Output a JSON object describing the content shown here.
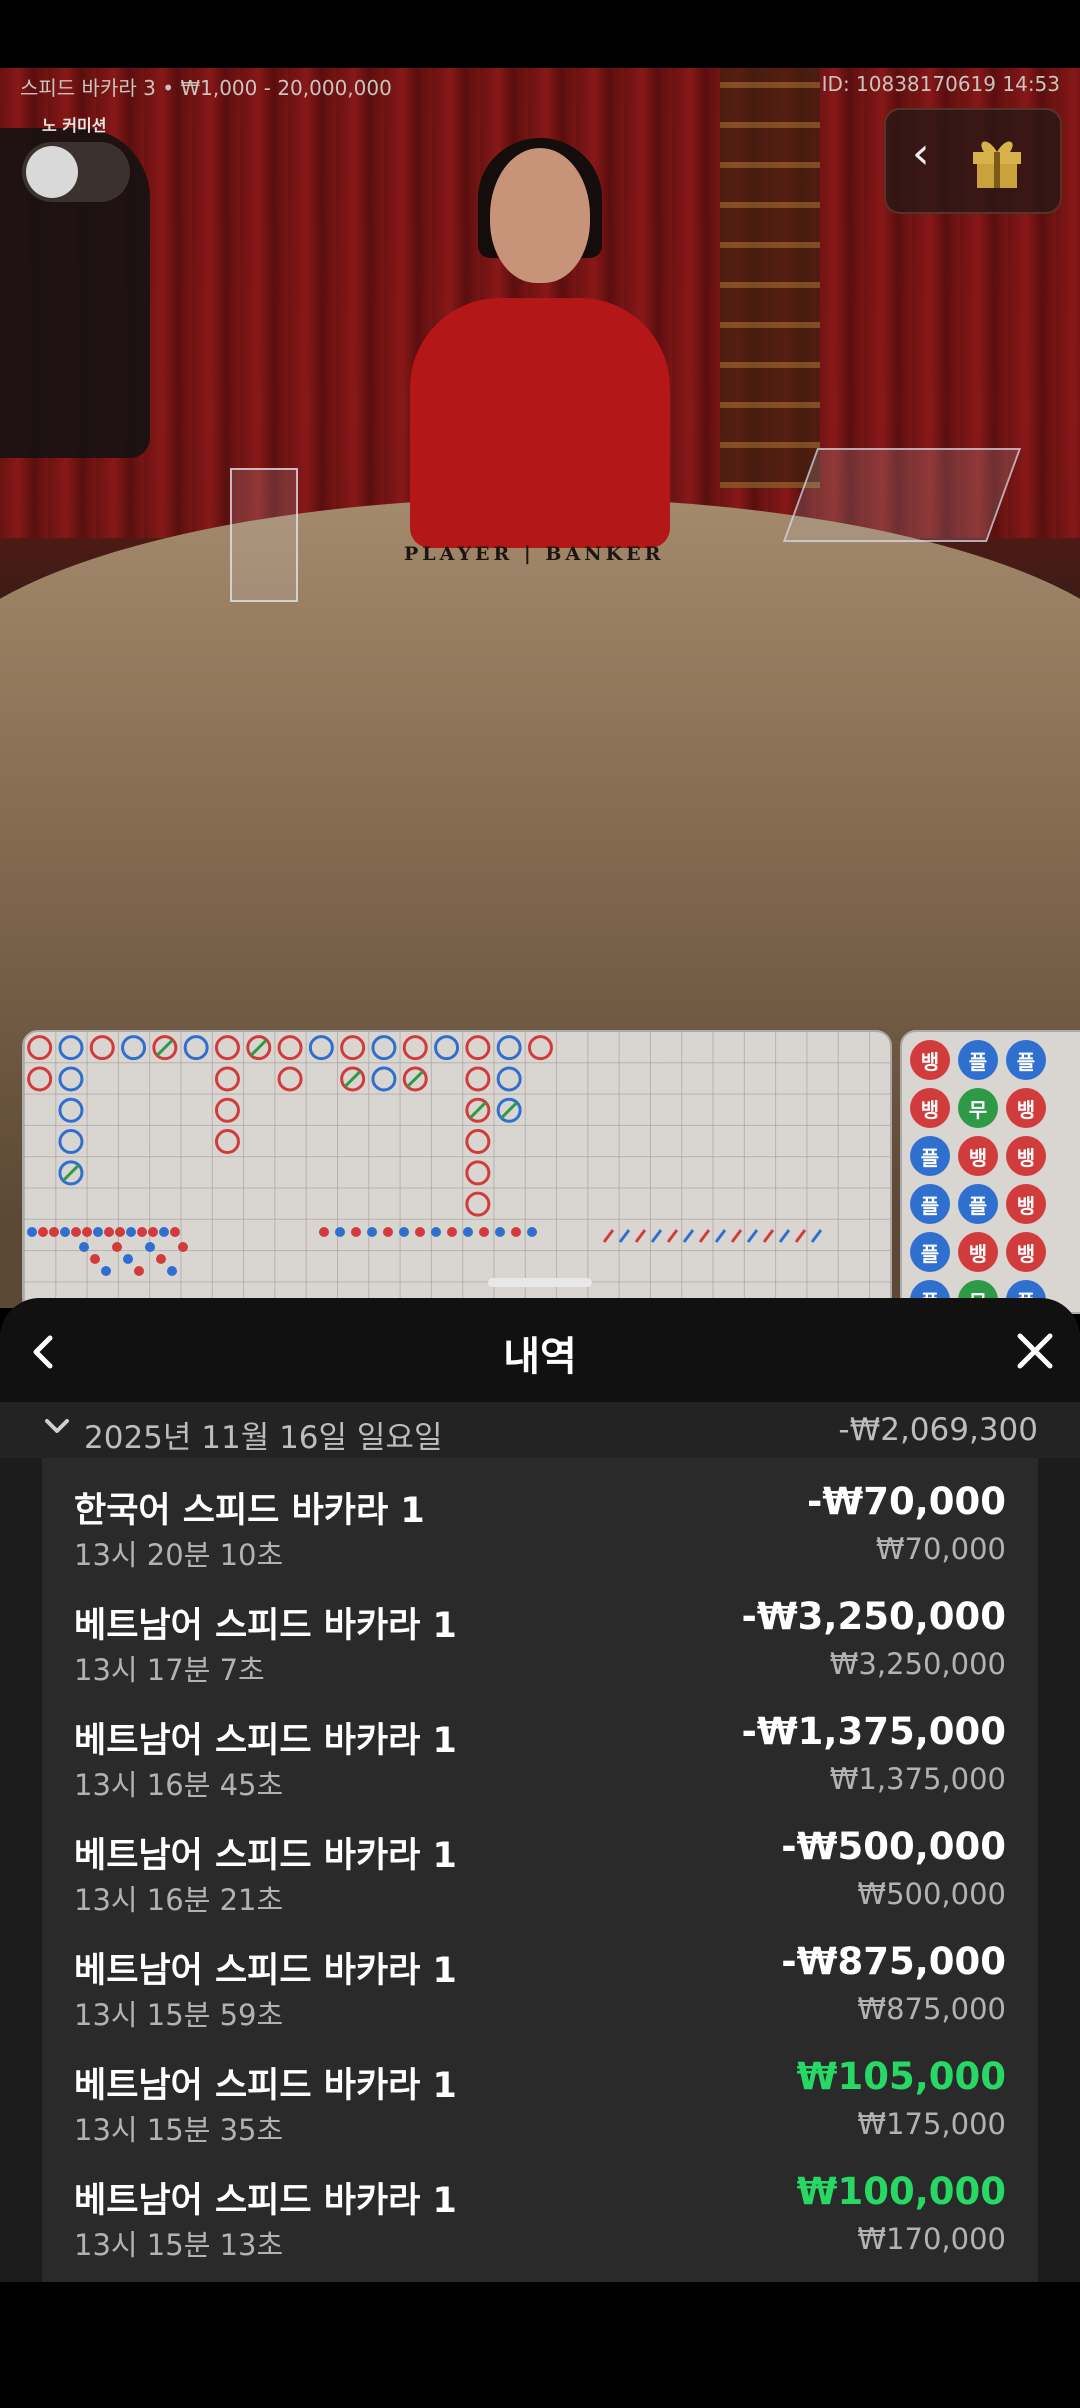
{
  "video": {
    "table_info": "스피드 바카라 3 • ₩1,000 - 20,000,000",
    "game_id": "ID: 10838170619 14:53",
    "no_commission_label": "노 커미션",
    "table_label": "PLAYER | BANKER"
  },
  "bead_road": {
    "labels": {
      "banker": "뱅",
      "player": "플",
      "tie": "무"
    },
    "colors": {
      "banker": "#d23b3b",
      "player": "#2f6fd0",
      "tie": "#2e9a47"
    }
  },
  "sheet": {
    "title": "내역",
    "date_group": {
      "date": "2025년 11월 16일 일요일",
      "total": "-₩2,069,300"
    },
    "items": [
      {
        "name": "한국어 스피드 바카라 1",
        "time": "13시 20분 10초",
        "amount": "-₩70,000",
        "stake": "₩70,000",
        "win": false
      },
      {
        "name": "베트남어 스피드 바카라 1",
        "time": "13시 17분 7초",
        "amount": "-₩3,250,000",
        "stake": "₩3,250,000",
        "win": false
      },
      {
        "name": "베트남어 스피드 바카라 1",
        "time": "13시 16분 45초",
        "amount": "-₩1,375,000",
        "stake": "₩1,375,000",
        "win": false
      },
      {
        "name": "베트남어 스피드 바카라 1",
        "time": "13시 16분 21초",
        "amount": "-₩500,000",
        "stake": "₩500,000",
        "win": false
      },
      {
        "name": "베트남어 스피드 바카라 1",
        "time": "13시 15분 59초",
        "amount": "-₩875,000",
        "stake": "₩875,000",
        "win": false
      },
      {
        "name": "베트남어 스피드 바카라 1",
        "time": "13시 15분 35초",
        "amount": "₩105,000",
        "stake": "₩175,000",
        "win": true
      },
      {
        "name": "베트남어 스피드 바카라 1",
        "time": "13시 15분 13초",
        "amount": "₩100,000",
        "stake": "₩170,000",
        "win": true
      }
    ]
  },
  "colors": {
    "win": "#27d865",
    "background": "#000000",
    "sheet": "#1c1c1c"
  },
  "icons": {
    "back": "chevron-left-icon",
    "close": "close-icon",
    "expand": "chevron-down-icon",
    "gift": "gift-icon"
  }
}
